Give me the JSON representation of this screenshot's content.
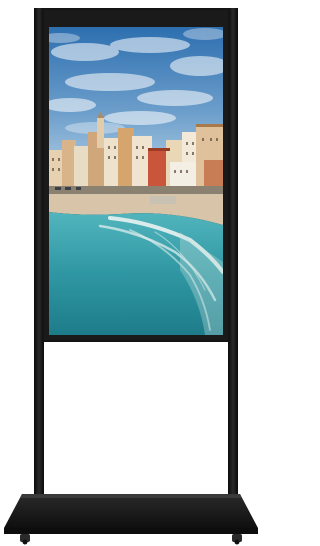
{
  "product": {
    "frame_color": "#141414",
    "base_color": "#1c1c1c",
    "caster_color": "#2a2a2a"
  },
  "screen": {
    "sky_top": "#2d6fb0",
    "sky_bottom": "#bcd6e8",
    "sea_deep": "#1e7c8a",
    "sea_shallow": "#52b5bd",
    "foam": "#e9f2f1",
    "sand": "#d8c4a8",
    "buildings_primary": "#e6d2b0",
    "buildings_accent": "#c9553a"
  }
}
